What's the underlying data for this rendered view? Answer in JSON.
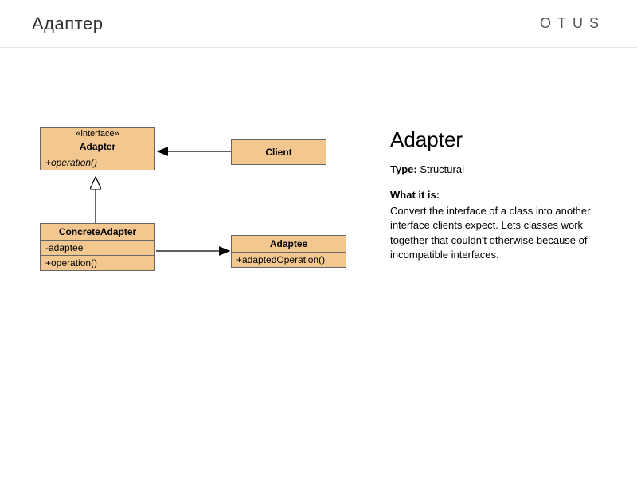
{
  "header": {
    "title": "Адаптер",
    "brand": "OTUS"
  },
  "diagram": {
    "adapter": {
      "stereotype": "«interface»",
      "name": "Adapter",
      "operation": "+operation()"
    },
    "client": {
      "name": "Client"
    },
    "concreteAdapter": {
      "name": "ConcreteAdapter",
      "field": "-adaptee",
      "operation": "+operation()"
    },
    "adaptee": {
      "name": "Adaptee",
      "operation": "+adaptedOperation()"
    }
  },
  "description": {
    "title": "Adapter",
    "typeLabel": "Type:",
    "typeValue": "Structural",
    "whatLabel": "What it is:",
    "whatText": "Convert the interface of a class into another interface clients expect. Lets classes work together that couldn't otherwise because of incompatible interfaces."
  }
}
